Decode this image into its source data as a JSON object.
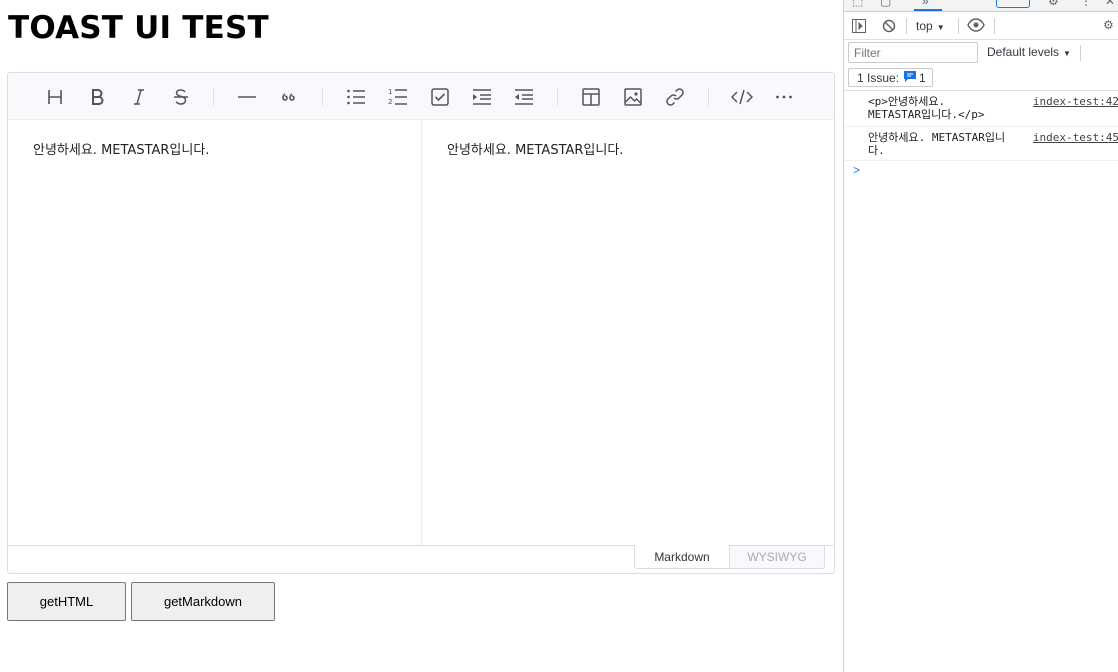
{
  "page": {
    "title": "TOAST UI TEST"
  },
  "editor": {
    "toolbar": [
      {
        "name": "heading-icon"
      },
      {
        "name": "bold-icon"
      },
      {
        "name": "italic-icon"
      },
      {
        "name": "strike-icon"
      },
      {
        "name": "hr-icon"
      },
      {
        "name": "quote-icon"
      },
      {
        "name": "bullet-list-icon"
      },
      {
        "name": "ordered-list-icon"
      },
      {
        "name": "task-list-icon"
      },
      {
        "name": "indent-icon"
      },
      {
        "name": "outdent-icon"
      },
      {
        "name": "table-icon"
      },
      {
        "name": "image-icon"
      },
      {
        "name": "link-icon"
      },
      {
        "name": "code-block-icon"
      },
      {
        "name": "more-icon"
      }
    ],
    "markdown_text": "안녕하세요. METASTAR입니다.",
    "preview_text": "안녕하세요. METASTAR입니다.",
    "modes": {
      "markdown": "Markdown",
      "wysiwyg": "WYSIWYG",
      "active": "Markdown"
    }
  },
  "buttons": {
    "get_html": "getHTML",
    "get_markdown": "getMarkdown"
  },
  "devtools": {
    "context": "top",
    "filter_placeholder": "Filter",
    "levels": "Default levels",
    "issues_label": "1 Issue:",
    "issues_count": "1",
    "console": [
      {
        "message": "<p>안녕하세요. METASTAR입니다.</p>",
        "source": "index-test:42"
      },
      {
        "message": "안녕하세요. METASTAR입니다.",
        "source": "index-test:45"
      }
    ],
    "prompt": ">"
  },
  "colors": {
    "toolbar_bg": "#f7f9fc",
    "border": "#dadde6",
    "accent_blue": "#1a73e8"
  }
}
